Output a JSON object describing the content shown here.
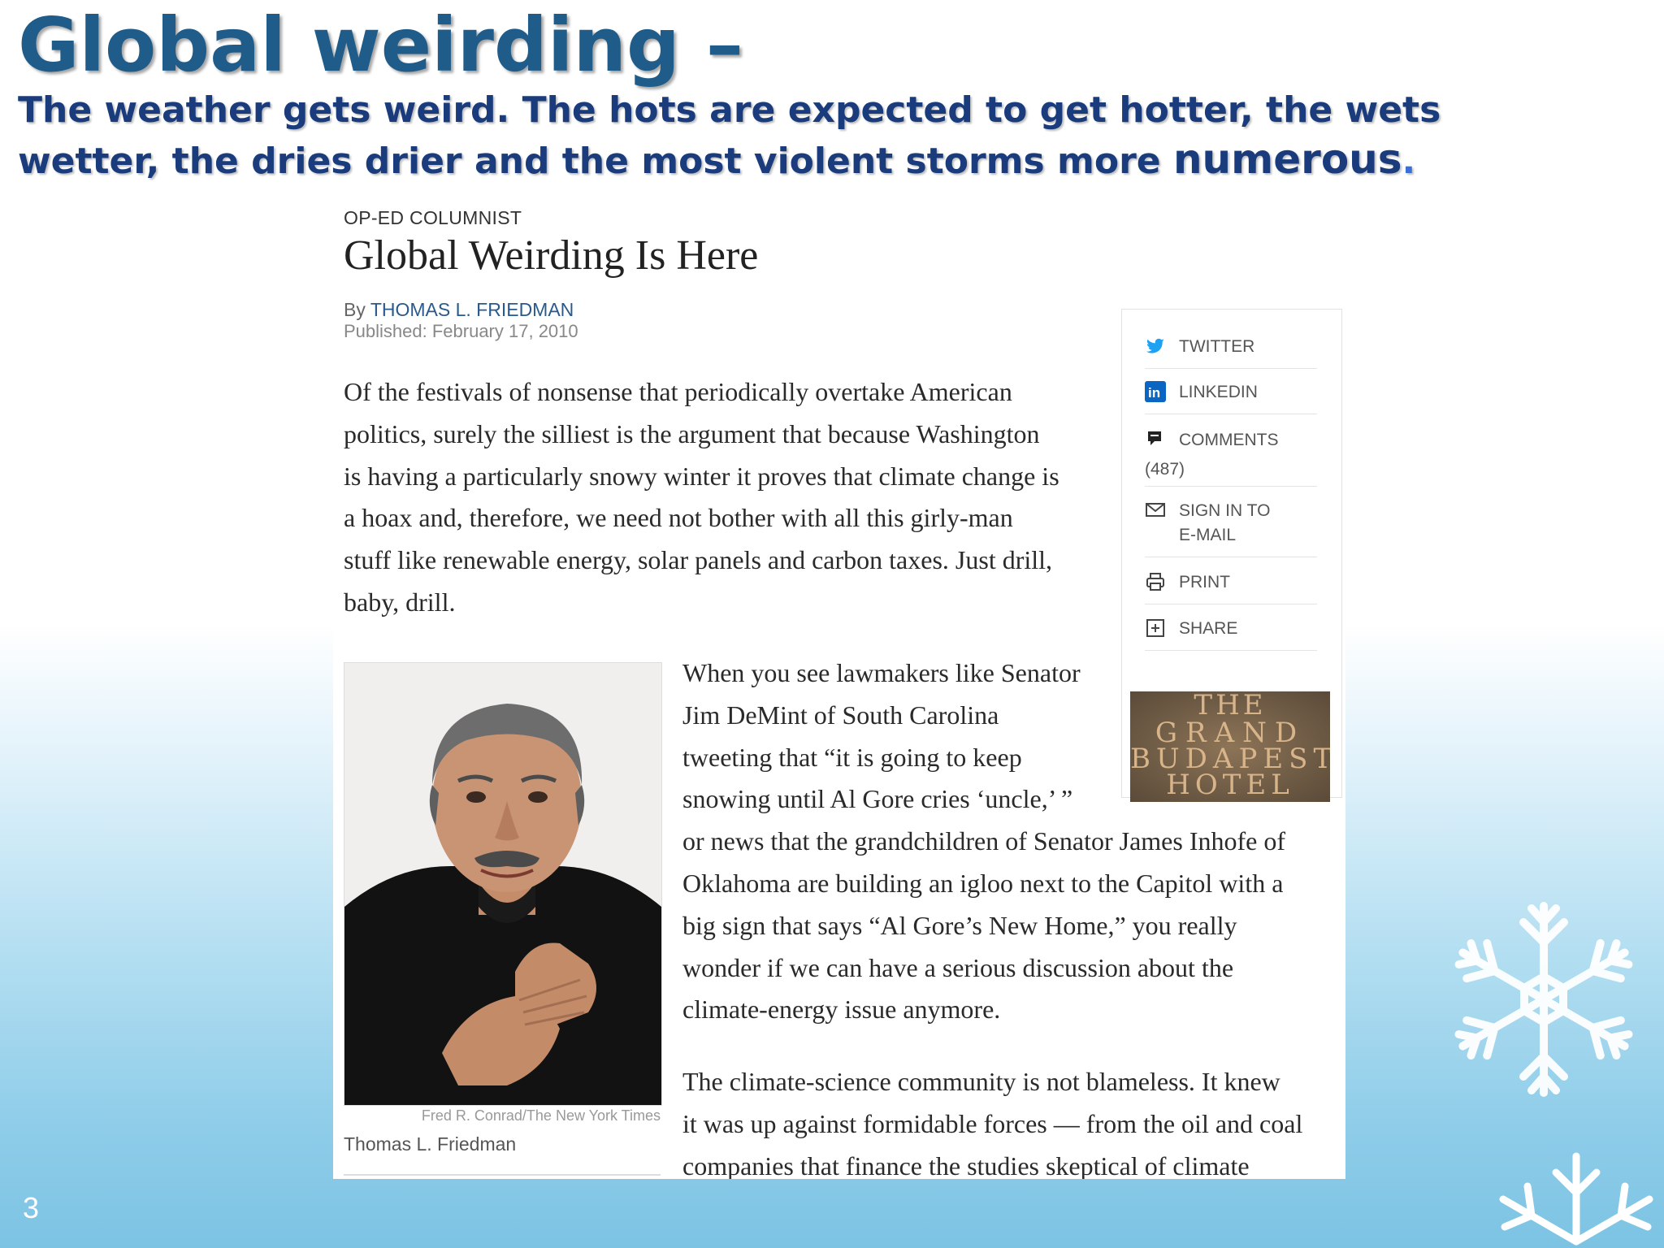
{
  "slide": {
    "title": "Global weirding –",
    "subtitle_main": "The weather gets weird. The hots are expected to get hotter, the wets wetter, the dries drier and the most violent storms more ",
    "subtitle_last": "numerous",
    "subtitle_dot": ".",
    "page_number": "3"
  },
  "article": {
    "kicker": "OP-ED COLUMNIST",
    "headline": "Global Weirding Is Here",
    "by": "By ",
    "author": "THOMAS L. FRIEDMAN",
    "published": "Published: February 17, 2010",
    "p1": [
      "Of the festivals of nonsense that periodically overtake American",
      "politics, surely the silliest is the argument that because Washington",
      "is having a particularly snowy winter it proves that climate change is",
      "a hoax and, therefore, we need not bother with all this girly-man",
      "stuff like renewable energy, solar panels and carbon taxes. Just drill,",
      "baby, drill."
    ],
    "p2": [
      "When you see lawmakers like Senator",
      "Jim DeMint of South Carolina",
      "tweeting that “it is going to keep",
      "snowing until Al Gore cries ‘uncle,’ ”",
      "or news that the grandchildren of Senator James Inhofe of",
      "Oklahoma are building an igloo next to the Capitol with a",
      "big sign that says “Al Gore’s New Home,” you really",
      "wonder if we can have a serious discussion about the",
      "climate-energy issue anymore."
    ],
    "p3": [
      "The climate-science community is not blameless. It knew",
      "it was up against formidable forces — from the oil and coal",
      "companies that finance the studies skeptical of climate"
    ],
    "photo_credit": "Fred R. Conrad/The New York Times",
    "photo_caption": "Thomas L. Friedman"
  },
  "share_tools": {
    "twitter": "TWITTER",
    "linkedin": "LINKEDIN",
    "comments": "COMMENTS",
    "comments_count": "(487)",
    "signin_line1": "SIGN IN TO",
    "signin_line2": "E-MAIL",
    "print": "PRINT",
    "share": "SHARE"
  },
  "ad": {
    "line1": "THE",
    "line2": "GRAND",
    "line3": "BUDAPEST",
    "line4": "HOTEL"
  },
  "colors": {
    "title": "#1f5c8a",
    "subtitle": "#1a3c7c",
    "author_link": "#2a5a8c",
    "twitter": "#1da1f2",
    "linkedin": "#0a66c2"
  }
}
